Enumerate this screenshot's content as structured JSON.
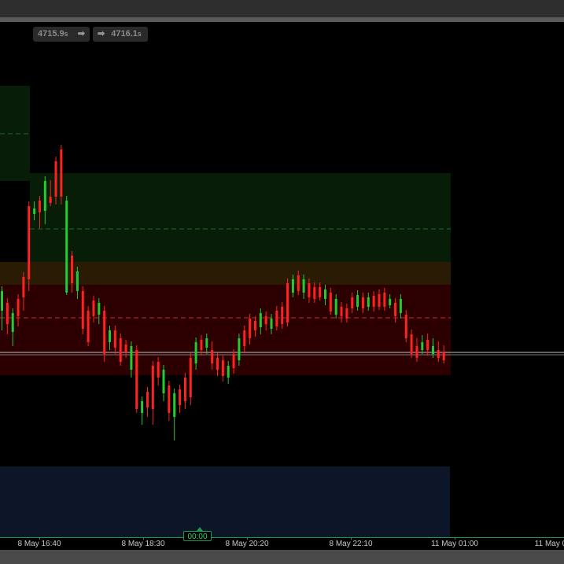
{
  "toolbar": {
    "bid_price": "4715.9",
    "bid_suffix": "s",
    "ask_price": "4716.1",
    "ask_suffix": "s",
    "arrow_glyph": "➡"
  },
  "cursor": {
    "time_label": "00:00"
  },
  "colors": {
    "bull": "#22cc33",
    "bear": "#ff2222",
    "supply_zone": "#071d07",
    "demand_zone_orange": "#2a1b05",
    "demand_zone_red": "#2c0000",
    "lower_zone": "#0c1628",
    "axis": "#1f9a4c"
  },
  "chart_data": {
    "type": "candlestick",
    "x_ticks": [
      "8 May 16:40",
      "8 May 18:30",
      "8 May 20:20",
      "8 May 22:10",
      "11 May 01:00",
      "11 May 0"
    ],
    "price_level_line": "current price ~ 449 row",
    "candles": [
      [
        370,
        395,
        380,
        420
      ],
      [
        385,
        412,
        405,
        425
      ],
      [
        398,
        422,
        410,
        440
      ],
      [
        380,
        402,
        385,
        415
      ],
      [
        352,
        378,
        360,
        395
      ],
      [
        262,
        355,
        268,
        370
      ],
      [
        265,
        272,
        262,
        280
      ],
      [
        255,
        270,
        262,
        290
      ],
      [
        230,
        268,
        240,
        285
      ],
      [
        250,
        258,
        235,
        262
      ],
      [
        205,
        250,
        215,
        260
      ],
      [
        190,
        250,
        195,
        260
      ],
      [
        255,
        372,
        260,
        375
      ],
      [
        325,
        360,
        330,
        372
      ],
      [
        345,
        370,
        350,
        380
      ],
      [
        370,
        418,
        375,
        425
      ],
      [
        395,
        435,
        400,
        440
      ],
      [
        382,
        402,
        385,
        410
      ],
      [
        385,
        400,
        390,
        412
      ],
      [
        395,
        450,
        398,
        460
      ],
      [
        420,
        435,
        425,
        445
      ],
      [
        420,
        442,
        425,
        450
      ],
      [
        430,
        460,
        435,
        465
      ],
      [
        438,
        448,
        440,
        455
      ],
      [
        440,
        470,
        442,
        480
      ],
      [
        445,
        520,
        448,
        525
      ],
      [
        510,
        525,
        512,
        540
      ],
      [
        498,
        518,
        500,
        530
      ],
      [
        465,
        520,
        470,
        540
      ],
      [
        460,
        480,
        465,
        490
      ],
      [
        470,
        500,
        475,
        510
      ],
      [
        490,
        525,
        495,
        535
      ],
      [
        500,
        530,
        505,
        560
      ],
      [
        495,
        515,
        500,
        525
      ],
      [
        480,
        510,
        485,
        520
      ],
      [
        455,
        505,
        460,
        515
      ],
      [
        435,
        462,
        440,
        470
      ],
      [
        432,
        445,
        436,
        452
      ],
      [
        430,
        442,
        434,
        450
      ],
      [
        445,
        462,
        440,
        470
      ],
      [
        455,
        470,
        458,
        478
      ],
      [
        458,
        478,
        462,
        485
      ],
      [
        465,
        480,
        470,
        488
      ],
      [
        450,
        468,
        455,
        475
      ],
      [
        430,
        458,
        436,
        465
      ],
      [
        420,
        440,
        425,
        448
      ],
      [
        405,
        430,
        410,
        438
      ],
      [
        408,
        420,
        412,
        428
      ],
      [
        398,
        416,
        402,
        425
      ],
      [
        402,
        412,
        405,
        420
      ],
      [
        405,
        418,
        408,
        425
      ],
      [
        395,
        415,
        400,
        420
      ],
      [
        390,
        412,
        395,
        418
      ],
      [
        360,
        410,
        365,
        415
      ],
      [
        355,
        372,
        360,
        378
      ],
      [
        350,
        370,
        355,
        375
      ],
      [
        355,
        372,
        358,
        380
      ],
      [
        360,
        378,
        365,
        385
      ],
      [
        365,
        380,
        370,
        385
      ],
      [
        365,
        378,
        370,
        382
      ],
      [
        368,
        380,
        372,
        388
      ],
      [
        372,
        396,
        378,
        400
      ],
      [
        380,
        400,
        385,
        405
      ],
      [
        390,
        402,
        394,
        410
      ],
      [
        392,
        405,
        396,
        410
      ],
      [
        378,
        392,
        382,
        398
      ],
      [
        375,
        390,
        380,
        395
      ],
      [
        378,
        392,
        382,
        398
      ],
      [
        378,
        390,
        382,
        395
      ],
      [
        376,
        390,
        380,
        396
      ],
      [
        374,
        390,
        378,
        394
      ],
      [
        372,
        390,
        376,
        395
      ],
      [
        380,
        388,
        384,
        392
      ],
      [
        385,
        402,
        388,
        410
      ],
      [
        380,
        398,
        385,
        405
      ],
      [
        400,
        430,
        405,
        435
      ],
      [
        425,
        450,
        430,
        455
      ],
      [
        440,
        455,
        436,
        460
      ],
      [
        435,
        445,
        432,
        450
      ],
      [
        432,
        445,
        430,
        452
      ],
      [
        440,
        450,
        436,
        455
      ],
      [
        445,
        455,
        440,
        460
      ],
      [
        448,
        458,
        445,
        462
      ]
    ]
  }
}
